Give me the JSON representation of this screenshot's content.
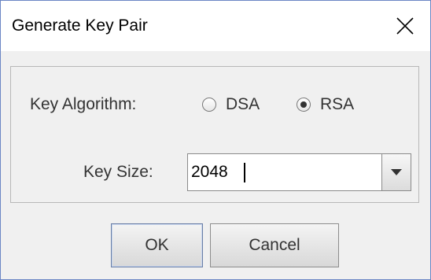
{
  "dialog": {
    "title": "Generate Key Pair",
    "close_icon": "close-x-icon"
  },
  "form": {
    "algorithm_label": "Key Algorithm:",
    "algorithm_options": [
      {
        "label": "DSA",
        "selected": false
      },
      {
        "label": "RSA",
        "selected": true
      }
    ],
    "key_size_label": "Key Size:",
    "key_size_value": "2048",
    "key_size_dropdown_icon": "chevron-down-icon"
  },
  "buttons": {
    "ok_label": "OK",
    "cancel_label": "Cancel"
  },
  "colors": {
    "window_border": "#6b86c4",
    "dialog_bg": "#f0f0f0",
    "default_button_border": "#6a7fa6"
  }
}
